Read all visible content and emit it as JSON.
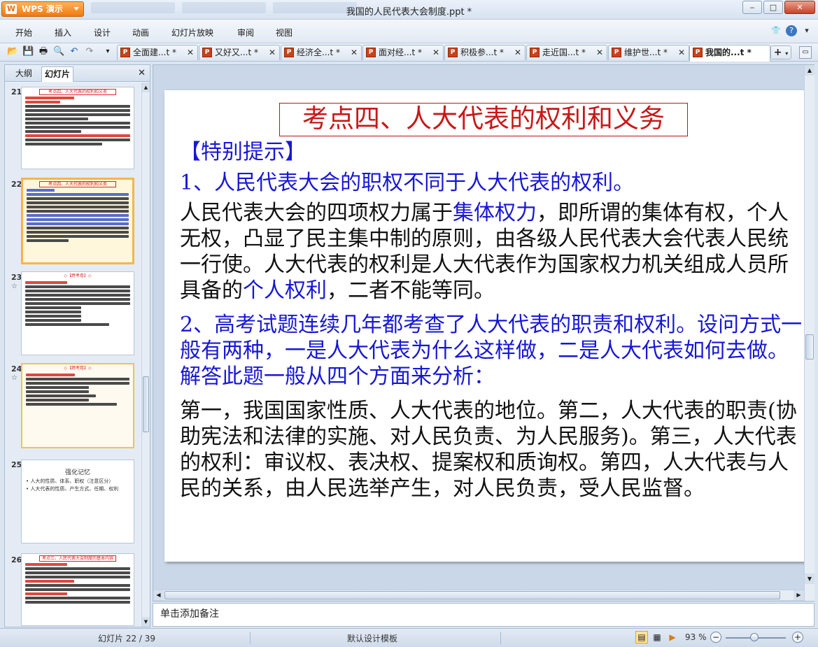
{
  "app": {
    "name": "WPS 演示",
    "logo_letter": "W",
    "window_title": "我国的人民代表大会制度.ppt *"
  },
  "menu": [
    "开始",
    "插入",
    "设计",
    "动画",
    "幻灯片放映",
    "审阅",
    "视图"
  ],
  "doc_tabs": [
    {
      "label": "全面建...t *",
      "active": false
    },
    {
      "label": "又好又...t *",
      "active": false
    },
    {
      "label": "经济全...t *",
      "active": false
    },
    {
      "label": "面对经...t *",
      "active": false
    },
    {
      "label": "积极参...t *",
      "active": false
    },
    {
      "label": "走近国...t *",
      "active": false
    },
    {
      "label": "维护世...t *",
      "active": false
    },
    {
      "label": "我国的...t *",
      "active": true
    }
  ],
  "sidebar": {
    "tabs": [
      "大纲",
      "幻灯片"
    ],
    "active_tab": "幻灯片",
    "slides": [
      {
        "number": "21",
        "title": "考点四、人大代表的权利和义务",
        "star": false,
        "selected": false
      },
      {
        "number": "22",
        "title": "考点四、人大代表的权利和义务",
        "star": false,
        "selected": true
      },
      {
        "number": "23",
        "title": "◇【跨考卷】◇",
        "star": true,
        "selected": false
      },
      {
        "number": "24",
        "title": "◇【跨考卷】◇",
        "star": true,
        "selected": false
      },
      {
        "number": "25",
        "title": "强化记忆",
        "star": false,
        "selected": false,
        "lines": [
          "• 人大的性质、体系、职权（注意区分）",
          "• 人大代表的性质、产生方式、任期、权利"
        ]
      },
      {
        "number": "26",
        "title": "考点三、人民代表大会制度的基本内容",
        "star": false,
        "selected": false
      }
    ]
  },
  "slide": {
    "title": "考点四、人大代表的权利和义务",
    "hint": "【特别提示】",
    "point1": "1、人民代表大会的职权不同于人大代表的权利。",
    "body1_a": "人民代表大会的四项权力属于",
    "body1_hl1": "集体权力",
    "body1_b": "，即所谓的集体有权，个人无权，凸显了民主集中制的原则，由各级人民代表大会代表人民统一行使。人大代表的权利是人大代表作为国家权力机关组成人员所具备的",
    "body1_hl2": "个人权利",
    "body1_c": "，二者不能等同。",
    "point2": "2、高考试题连续几年都考查了人大代表的职责和权利。设问方式一般有两种，一是人大代表为什么这样做，二是人大代表如何去做。解答此题一般从四个方面来分析：",
    "body2": "第一，我国国家性质、人大代表的地位。第二，人大代表的职责(协助宪法和法律的实施、对人民负责、为人民服务)。第三，人大代表的权利：审议权、表决权、提案权和质询权。第四，人大代表与人民的关系，由人民选举产生，对人民负责，受人民监督。"
  },
  "notes_placeholder": "单击添加备注",
  "status": {
    "slide_counter": "幻灯片 22 / 39",
    "template": "默认设计模板",
    "zoom": "93 %"
  },
  "colors": {
    "accent_orange": "#f07a10",
    "title_red": "#c81818",
    "highlight_blue": "#1717d6"
  }
}
